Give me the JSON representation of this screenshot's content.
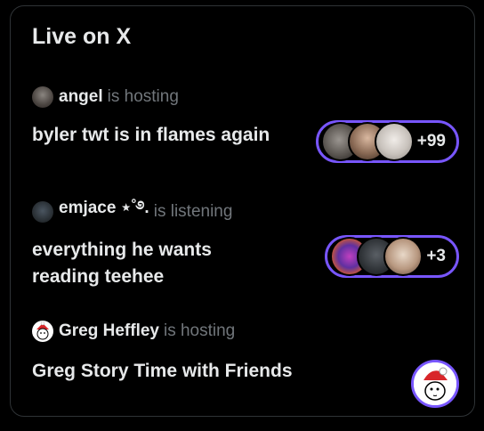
{
  "widget": {
    "title": "Live on X"
  },
  "spaces": [
    {
      "host_name": "angel",
      "host_role": "is hosting",
      "title": "byler twt is in flames again",
      "listener_count": "+99"
    },
    {
      "host_name": "emjace ⋆˚࿔.",
      "host_role": "is listening",
      "title": "everything he wants reading teehee",
      "listener_count": "+3"
    },
    {
      "host_name": "Greg Heffley",
      "host_role": "is hosting",
      "title": "Greg Story Time with Friends"
    }
  ],
  "colors": {
    "accent": "#7856ff",
    "text": "#e7e9ea",
    "muted": "#71767b",
    "border": "#2f3336"
  }
}
